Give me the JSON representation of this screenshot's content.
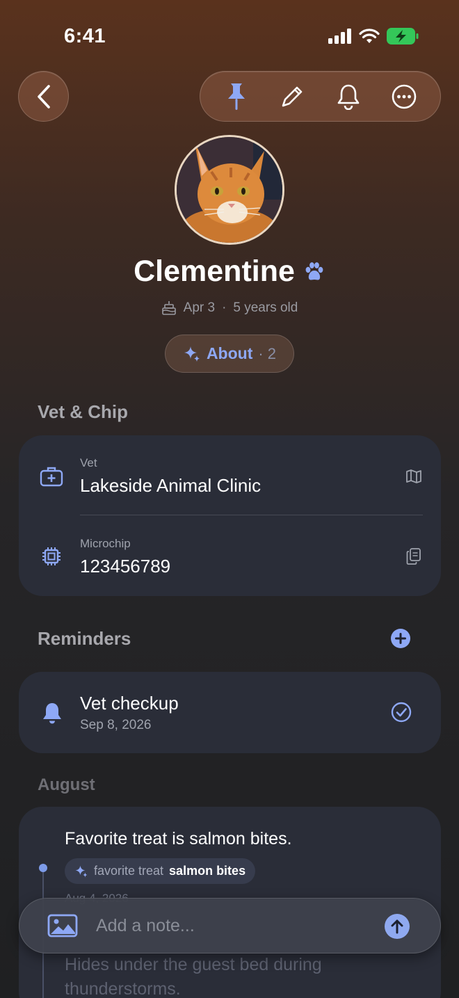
{
  "status_bar": {
    "time": "6:41"
  },
  "pet": {
    "name": "Clementine",
    "birthday": "Apr 3",
    "age": "5 years old",
    "separator": "·"
  },
  "about": {
    "label": "About",
    "count": "· 2"
  },
  "vet_section": {
    "title": "Vet & Chip",
    "vet": {
      "label": "Vet",
      "value": "Lakeside Animal Clinic"
    },
    "microchip": {
      "label": "Microchip",
      "value": "123456789"
    }
  },
  "reminders": {
    "title": "Reminders",
    "items": [
      {
        "title": "Vet checkup",
        "date": "Sep 8, 2026"
      }
    ]
  },
  "notes": {
    "month": "August",
    "items": [
      {
        "text": "Favorite treat is salmon bites.",
        "tag_key": "favorite treat",
        "tag_value": "salmon bites",
        "date": "Aug 4, 2026"
      },
      {
        "text": "Hides under the guest bed during thunderstorms."
      }
    ]
  },
  "composer": {
    "placeholder": "Add a note..."
  },
  "colors": {
    "accent": "#8ea8f5",
    "card": "#2a2d38",
    "battery": "#34c759"
  },
  "icons": [
    "back-chevron-icon",
    "pin-icon",
    "pencil-icon",
    "bell-icon",
    "more-icon",
    "paw-icon",
    "cake-icon",
    "sparkles-icon",
    "medical-kit-icon",
    "map-icon",
    "chip-icon",
    "copy-icon",
    "plus-circle-icon",
    "checkmark-circle-icon",
    "image-icon",
    "arrow-up-icon"
  ]
}
